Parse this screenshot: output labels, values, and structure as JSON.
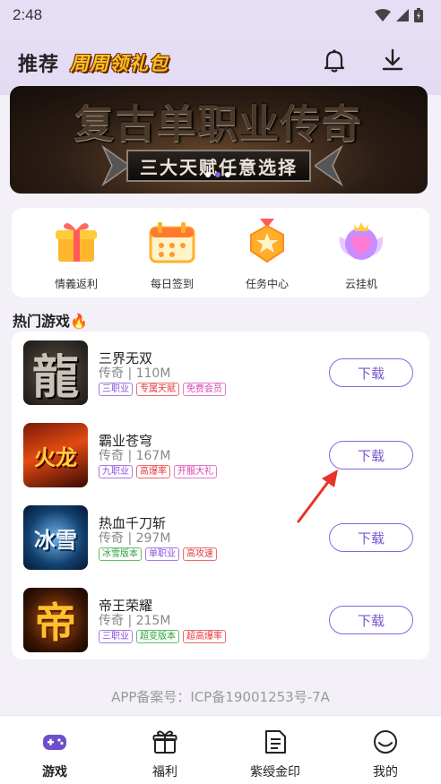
{
  "status_bar": {
    "time": "2:48"
  },
  "header": {
    "title": "推荐",
    "promo": "周周领礼包"
  },
  "banner": {
    "headline": "复古单职业传奇",
    "subline": "三大天赋任意选择",
    "slide_count": 3,
    "active_slide": 2
  },
  "quick_menu": [
    {
      "label": "情義返利",
      "icon": "gift-box-icon"
    },
    {
      "label": "每日签到",
      "icon": "calendar-icon"
    },
    {
      "label": "任务中心",
      "icon": "medal-icon"
    },
    {
      "label": "云挂机",
      "icon": "heart-wings-icon"
    }
  ],
  "section": {
    "title": "热门游戏",
    "icon": "fire-icon"
  },
  "games": [
    {
      "name": "三界无双",
      "meta": "传奇 | 110M",
      "button": "下载",
      "tags": [
        {
          "text": "三职业",
          "color": "purple"
        },
        {
          "text": "专属天赋",
          "color": "red"
        },
        {
          "text": "免费会员",
          "color": "pink"
        }
      ]
    },
    {
      "name": "霸业苍穹",
      "meta": "传奇 | 167M",
      "button": "下载",
      "tags": [
        {
          "text": "九职业",
          "color": "purple"
        },
        {
          "text": "高爆率",
          "color": "red"
        },
        {
          "text": "开服大礼",
          "color": "pink"
        }
      ]
    },
    {
      "name": "热血千刀斩",
      "meta": "传奇 | 297M",
      "button": "下载",
      "tags": [
        {
          "text": "冰雪版本",
          "color": "green"
        },
        {
          "text": "单职业",
          "color": "purple"
        },
        {
          "text": "高攻速",
          "color": "red"
        }
      ]
    },
    {
      "name": "帝王荣耀",
      "meta": "传奇 | 215M",
      "button": "下载",
      "tags": [
        {
          "text": "三职业",
          "color": "purple"
        },
        {
          "text": "超变版本",
          "color": "green"
        },
        {
          "text": "超高爆率",
          "color": "red"
        }
      ]
    }
  ],
  "thumb_text": [
    "龍",
    "火龙",
    "冰雪",
    "帝"
  ],
  "record": "APP备案号：ICP备19001253号-7A",
  "bottom_nav": [
    {
      "label": "游戏",
      "icon": "gamepad-icon",
      "active": true
    },
    {
      "label": "福利",
      "icon": "gift-icon",
      "active": false
    },
    {
      "label": "紫绶金印",
      "icon": "document-icon",
      "active": false
    },
    {
      "label": "我的",
      "icon": "profile-icon",
      "active": false
    }
  ],
  "colors": {
    "accent": "#8c64d6",
    "header_bg": "#e6def5",
    "page_bg": "#f3f0f8"
  }
}
